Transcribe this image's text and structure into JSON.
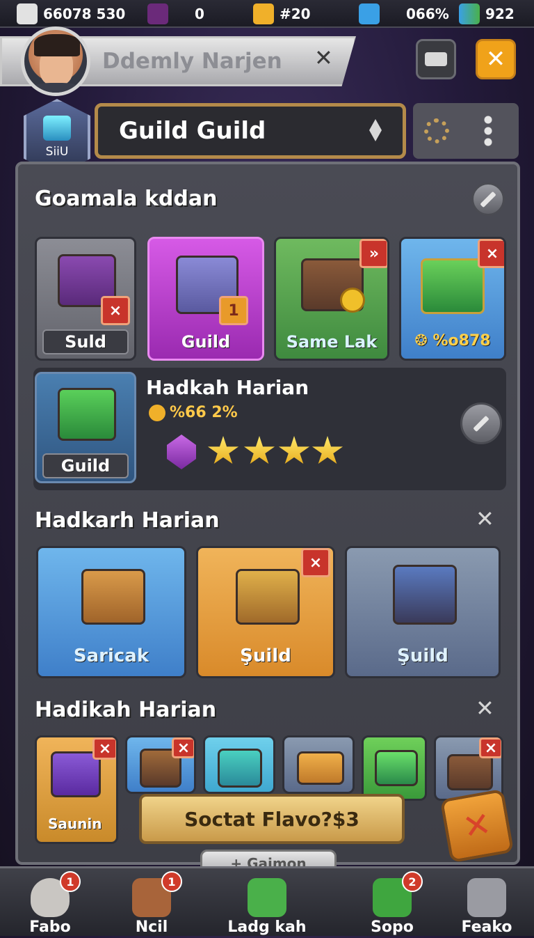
{
  "resources": {
    "coins": "66078 530",
    "gems": "0",
    "tickets": "#20",
    "energy": "066%",
    "level": "922"
  },
  "profile": {
    "name": "Ddemly Narjen"
  },
  "guild": {
    "badge_label": "SiiU",
    "selected": "Guild Guild"
  },
  "sections": [
    {
      "title": "Goamala kddan",
      "items": [
        {
          "label": "Suld",
          "badge": "×",
          "color": "#7b7c84"
        },
        {
          "label": "Guild",
          "badge": "1",
          "color": "#c13fd1"
        },
        {
          "label": "Same Lak",
          "badge": "»",
          "color": "#5a9a4a"
        },
        {
          "label": "❂ %o878",
          "badge": "×",
          "color": "#3f8bd0"
        }
      ]
    },
    {
      "title": "Hadkarh Harian",
      "items": [
        {
          "label": "Saricak",
          "color": "#3f89d0"
        },
        {
          "label": "Şuild",
          "badge": "×",
          "color": "#e39b2e"
        },
        {
          "label": "Şuild",
          "color": "#5a6a8a"
        }
      ]
    },
    {
      "title": "Hadikah Harian",
      "items": [
        {
          "label": "Saunin",
          "badge": "×",
          "color": "#d49a3a"
        },
        {
          "label": "",
          "badge": "×",
          "color": "#3f7fc9"
        },
        {
          "label": "",
          "color": "#3fa8d0"
        },
        {
          "label": "",
          "color": "#5a6a8a"
        },
        {
          "label": "",
          "color": "#4aa04a"
        },
        {
          "label": "",
          "badge": "×",
          "color": "#5a6a8a"
        }
      ]
    }
  ],
  "daily": {
    "item_label": "Guild",
    "title": "Hadkah Harian",
    "progress_text": "%66 2%",
    "stars": 4
  },
  "buy_button": "Soctat Flavo?$3",
  "pill_label": "+ Gaimon",
  "nav": [
    {
      "label": "Fabo",
      "badge": "1",
      "color": "#c9c6c2"
    },
    {
      "label": "Ncil",
      "badge": "1",
      "color": "#a8643a"
    },
    {
      "label": "Ladg kah",
      "badge": "",
      "color": "#4ab04a"
    },
    {
      "label": "Sopo",
      "badge": "2",
      "color": "#3fa63f"
    },
    {
      "label": "Feako",
      "badge": "",
      "color": "#9a9ba2"
    }
  ]
}
